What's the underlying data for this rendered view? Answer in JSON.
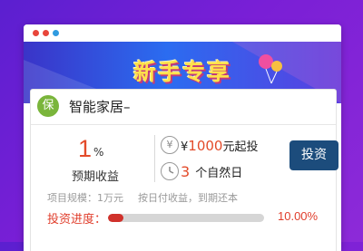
{
  "banner": {
    "title": "新手专享"
  },
  "product": {
    "badge": "保",
    "name": "智能家居–"
  },
  "rate": {
    "value": "1",
    "unit": "%",
    "label": "预期收益"
  },
  "invest": {
    "currency": "¥",
    "amount": "1000",
    "amount_suffix": "元起投",
    "term_value": "3",
    "term_unit": "个自然日",
    "button_label": "投资"
  },
  "notes": {
    "scale": "项目规模：1万元",
    "repay": "按日付收益，到期还本"
  },
  "progress": {
    "label": "投资进度：",
    "percent_text": "10.00%",
    "fraction": 0.1
  },
  "icons": {
    "currency": "yen-icon",
    "clock": "clock-icon"
  },
  "colors": {
    "accent": "#e34b2a",
    "button": "#1c4c7c",
    "badge": "#7ab53b"
  }
}
